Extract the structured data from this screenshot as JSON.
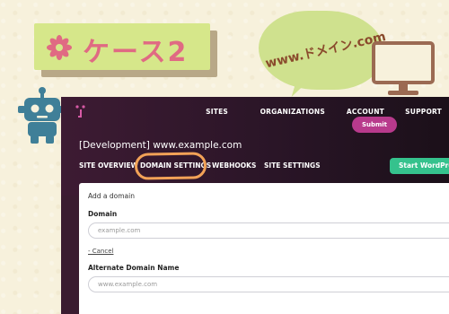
{
  "illustration": {
    "case_label": "ケース2",
    "speech_bubble_text": "www.ドメイン.com",
    "flower_icon": "flower-icon",
    "monitor_icon": "monitor-icon",
    "robot_icon": "robot-mascot-icon"
  },
  "colors": {
    "label_bg": "#d6e78a",
    "label_text": "#e06a83",
    "bubble_bg": "#cfe18e",
    "header_dark": "#3a1c30",
    "accent_green": "#35c28d",
    "highlight": "#f2a257",
    "submit": "#b83a8c"
  },
  "topnav": {
    "items": [
      "SITES",
      "ORGANIZATIONS",
      "ACCOUNT",
      "SUPPORT"
    ]
  },
  "site": {
    "title": "[Development] www.example.com"
  },
  "tabs": {
    "site_overview": "SITE OVERVIEW",
    "domain_settings": "DOMAIN SETTINGS",
    "webhooks": "WEBHOOKS",
    "site_settings": "SITE SETTINGS"
  },
  "start_button": "Start WordPress",
  "form": {
    "section_title": "Add a domain",
    "domain_label": "Domain",
    "domain_placeholder": "example.com",
    "cancel_link": "- Cancel",
    "alt_label": "Alternate Domain Name",
    "alt_placeholder": "www.example.com",
    "submit": "Submit"
  }
}
